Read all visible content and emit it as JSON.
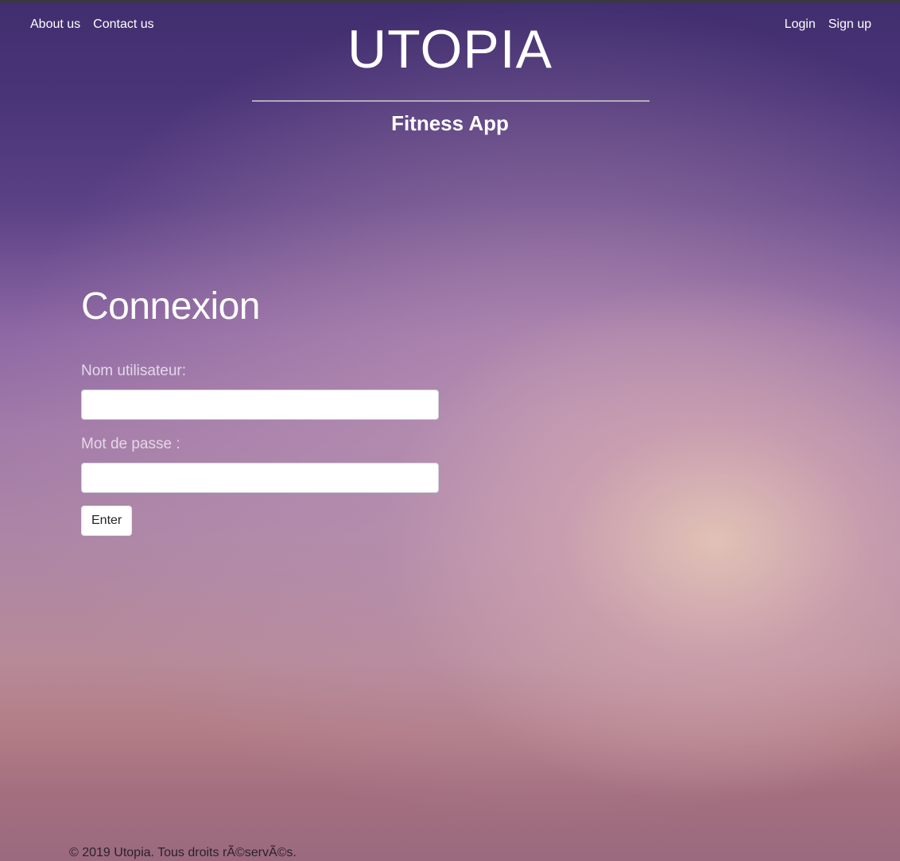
{
  "nav": {
    "left": [
      {
        "label": "About us"
      },
      {
        "label": "Contact us"
      }
    ],
    "right": [
      {
        "label": "Login"
      },
      {
        "label": "Sign up"
      }
    ]
  },
  "header": {
    "title": "UTOPIA",
    "subtitle": "Fitness App"
  },
  "login": {
    "title": "Connexion",
    "username_label": "Nom utilisateur:",
    "username_value": "",
    "password_label": "Mot de passe :",
    "password_value": "",
    "submit_label": "Enter"
  },
  "footer": {
    "text": "© 2019 Utopia. Tous droits rÃ©servÃ©s."
  }
}
